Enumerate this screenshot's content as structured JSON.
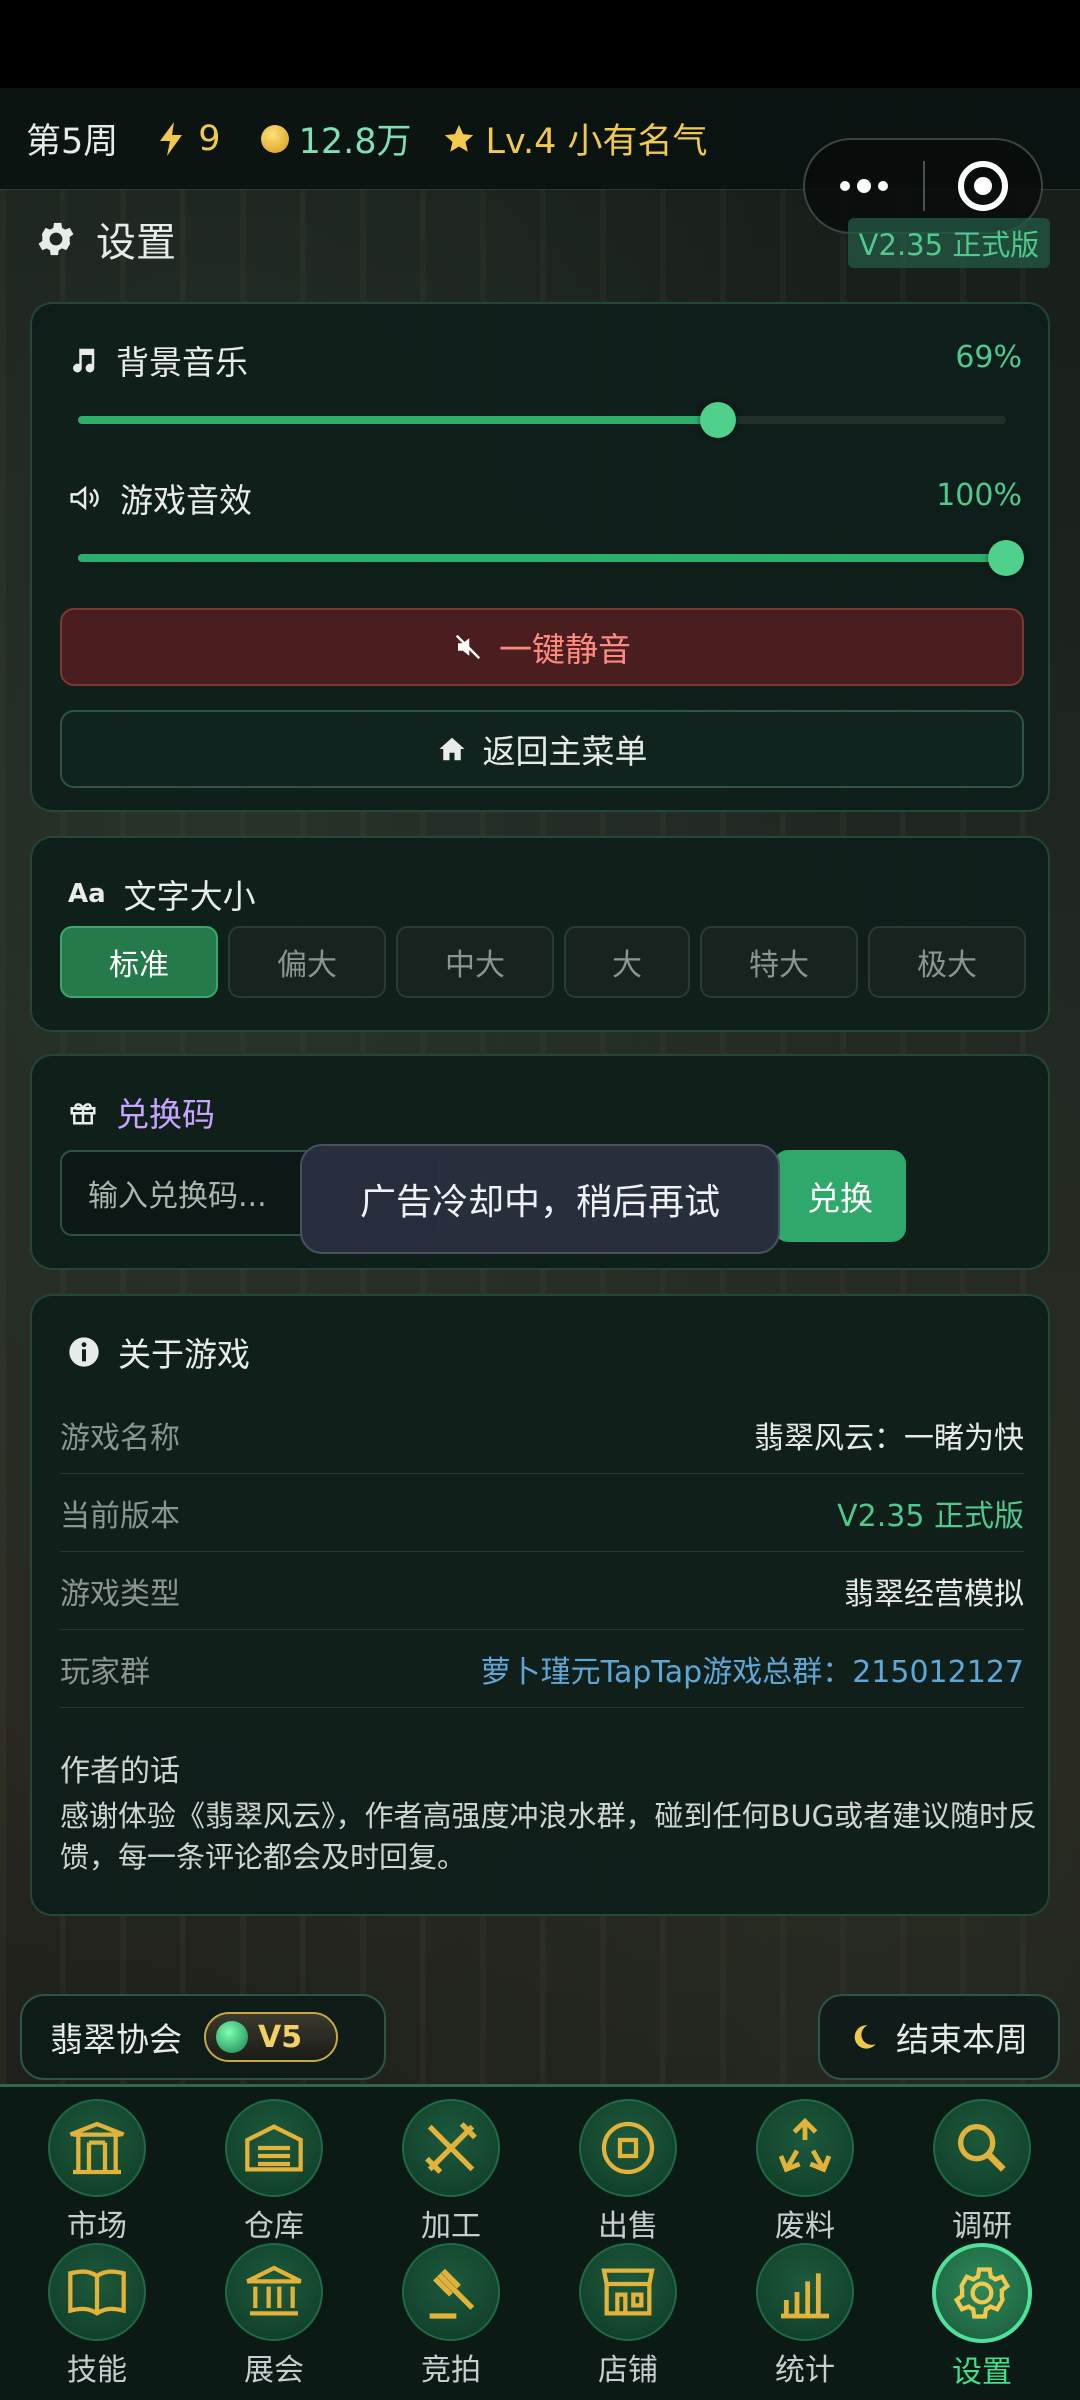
{
  "topbar": {
    "week": "第5周",
    "energy": "9",
    "coins": "12.8万",
    "level": "Lv.4 小有名气"
  },
  "page": {
    "title": "设置",
    "version_badge": "V2.35 正式版"
  },
  "audio": {
    "music_label": "背景音乐",
    "music_pct": "69%",
    "music_value": 0.69,
    "sfx_label": "游戏音效",
    "sfx_pct": "100%",
    "sfx_value": 1.0,
    "mute_label": "一键静音",
    "home_label": "返回主菜单"
  },
  "font_size": {
    "title": "文字大小",
    "icon_text": "Aa",
    "options": [
      "标准",
      "偏大",
      "中大",
      "大",
      "特大",
      "极大"
    ],
    "selected": "标准"
  },
  "redeem": {
    "title": "兑换码",
    "placeholder": "输入兑换码...",
    "button": "兑换"
  },
  "toast": {
    "text": "广告冷却中，稍后再试"
  },
  "about": {
    "title": "关于游戏",
    "rows": [
      {
        "key": "游戏名称",
        "value": "翡翠风云：一睹为快"
      },
      {
        "key": "当前版本",
        "value": "V2.35 正式版"
      },
      {
        "key": "游戏类型",
        "value": "翡翠经营模拟"
      },
      {
        "key": "玩家群",
        "value": "萝卜瑾元TapTap游戏总群：215012127"
      }
    ],
    "author_title": "作者的话",
    "author_text": "感谢体验《翡翠风云》，作者高强度冲浪水群，碰到任何BUG或者建议随时反馈，每一条评论都会及时回复。"
  },
  "association": {
    "label": "翡翠协会",
    "badge": "V5"
  },
  "end_week": {
    "label": "结束本周"
  },
  "nav": {
    "items": [
      {
        "label": "市场",
        "icon": "market-gate-icon"
      },
      {
        "label": "仓库",
        "icon": "warehouse-icon"
      },
      {
        "label": "加工",
        "icon": "tools-icon"
      },
      {
        "label": "出售",
        "icon": "coin-icon"
      },
      {
        "label": "废料",
        "icon": "recycle-icon"
      },
      {
        "label": "调研",
        "icon": "magnifier-icon"
      },
      {
        "label": "技能",
        "icon": "book-icon"
      },
      {
        "label": "展会",
        "icon": "museum-icon"
      },
      {
        "label": "竞拍",
        "icon": "gavel-icon"
      },
      {
        "label": "店铺",
        "icon": "shop-icon"
      },
      {
        "label": "统计",
        "icon": "bar-chart-icon"
      },
      {
        "label": "设置",
        "icon": "gear-icon"
      }
    ],
    "active": "设置"
  },
  "colors": {
    "accent": "#2fa86b",
    "gold": "#f2c94c",
    "danger": "#ff8a80"
  }
}
